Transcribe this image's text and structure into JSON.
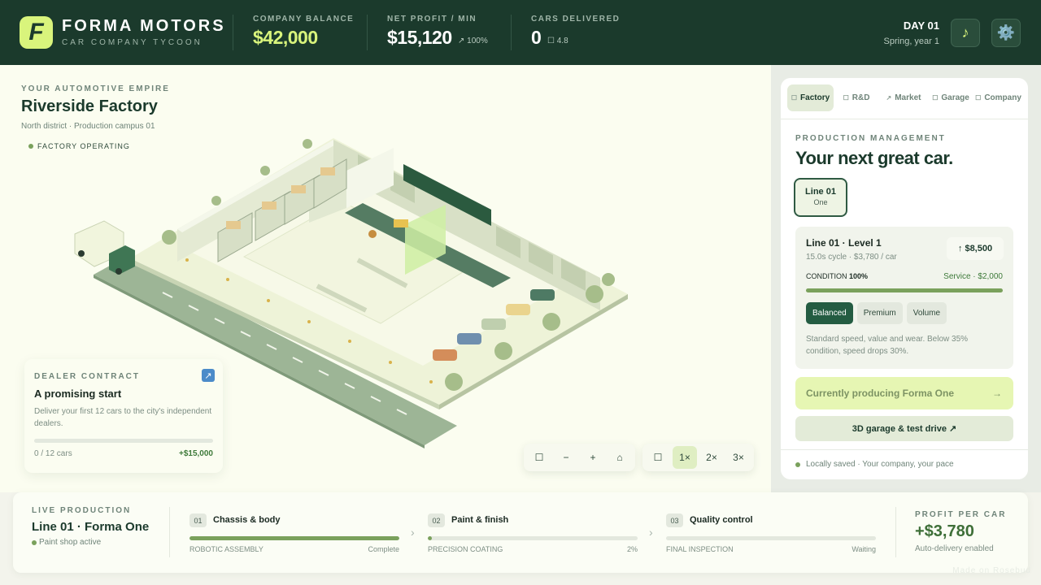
{
  "header": {
    "logo_letter": "F",
    "brand": "FORMA MOTORS",
    "tagline": "CAR COMPANY TYCOON",
    "balance_label": "COMPANY BALANCE",
    "balance_value": "$42,000",
    "profit_label": "NET PROFIT / MIN",
    "profit_value": "$15,120",
    "profit_change": "↗ 100%",
    "delivered_label": "CARS DELIVERED",
    "delivered_value": "0",
    "rating": "☐ 4.8",
    "day": "DAY 01",
    "season": "Spring, year 1",
    "music_icon": "♪",
    "settings_icon": "⚙️"
  },
  "factory": {
    "eyebrow": "YOUR AUTOMOTIVE EMPIRE",
    "name": "Riverside Factory",
    "location": "North district · Production campus 01",
    "status": "FACTORY OPERATING"
  },
  "contract": {
    "eyebrow": "DEALER CONTRACT",
    "icon": "↗",
    "title": "A promising start",
    "description": "Deliver your first 12 cars to the city's independent dealers.",
    "progress": 0,
    "count": "0 / 12 cars",
    "reward": "+$15,000"
  },
  "controls": {
    "rotate": "☐",
    "zoom_out": "−",
    "zoom_in": "+",
    "home": "⌂",
    "pause": "☐",
    "speed_1": "1×",
    "speed_2": "2×",
    "speed_3": "3×",
    "active_speed": "1×"
  },
  "tabs": [
    {
      "icon": "☐",
      "label": "Factory",
      "active": true
    },
    {
      "icon": "☐",
      "label": "R&D",
      "active": false
    },
    {
      "icon": "↗",
      "label": "Market",
      "active": false
    },
    {
      "icon": "☐",
      "label": "Garage",
      "active": false
    },
    {
      "icon": "☐",
      "label": "Company",
      "active": false
    }
  ],
  "panel": {
    "eyebrow": "PRODUCTION MANAGEMENT",
    "title": "Your next great car.",
    "line_button": {
      "line": "Line 01",
      "model": "One"
    },
    "line_title": "Line 01 · Level 1",
    "line_stats": "15.0s cycle · $3,780 / car",
    "upgrade": "↑ $8,500",
    "condition_label": "CONDITION",
    "condition_value": "100%",
    "condition_level": 1.0,
    "service": "Service · $2,000",
    "modes": [
      "Balanced",
      "Premium",
      "Volume"
    ],
    "active_mode": "Balanced",
    "mode_description": "Standard speed, value and wear. Below 35% condition, speed drops 30%.",
    "producing": "Currently producing Forma One",
    "producing_arrow": "→",
    "garage_button": "3D garage & test drive ↗",
    "saved": "Locally saved · Your company, your pace"
  },
  "production": {
    "eyebrow": "LIVE PRODUCTION",
    "title": "Line 01 · Forma One",
    "status": "Paint shop active",
    "stages": [
      {
        "num": "01",
        "name": "Chassis & body",
        "caption": "ROBOTIC ASSEMBLY",
        "state": "Complete",
        "progress": 1.0
      },
      {
        "num": "02",
        "name": "Paint & finish",
        "caption": "PRECISION COATING",
        "state": "2%",
        "progress": 0.02
      },
      {
        "num": "03",
        "name": "Quality control",
        "caption": "FINAL INSPECTION",
        "state": "Waiting",
        "progress": 0
      }
    ],
    "chevron": "›",
    "profit_label": "PROFIT PER CAR",
    "profit_value": "+$3,780",
    "profit_sub": "Auto-delivery enabled"
  },
  "credit": "Made on Rosebud",
  "colors": {
    "header_bg": "#1b3a2c",
    "accent_lime": "#d9f47c",
    "progress_green": "#7aa15c",
    "active_mode": "#245c42"
  }
}
